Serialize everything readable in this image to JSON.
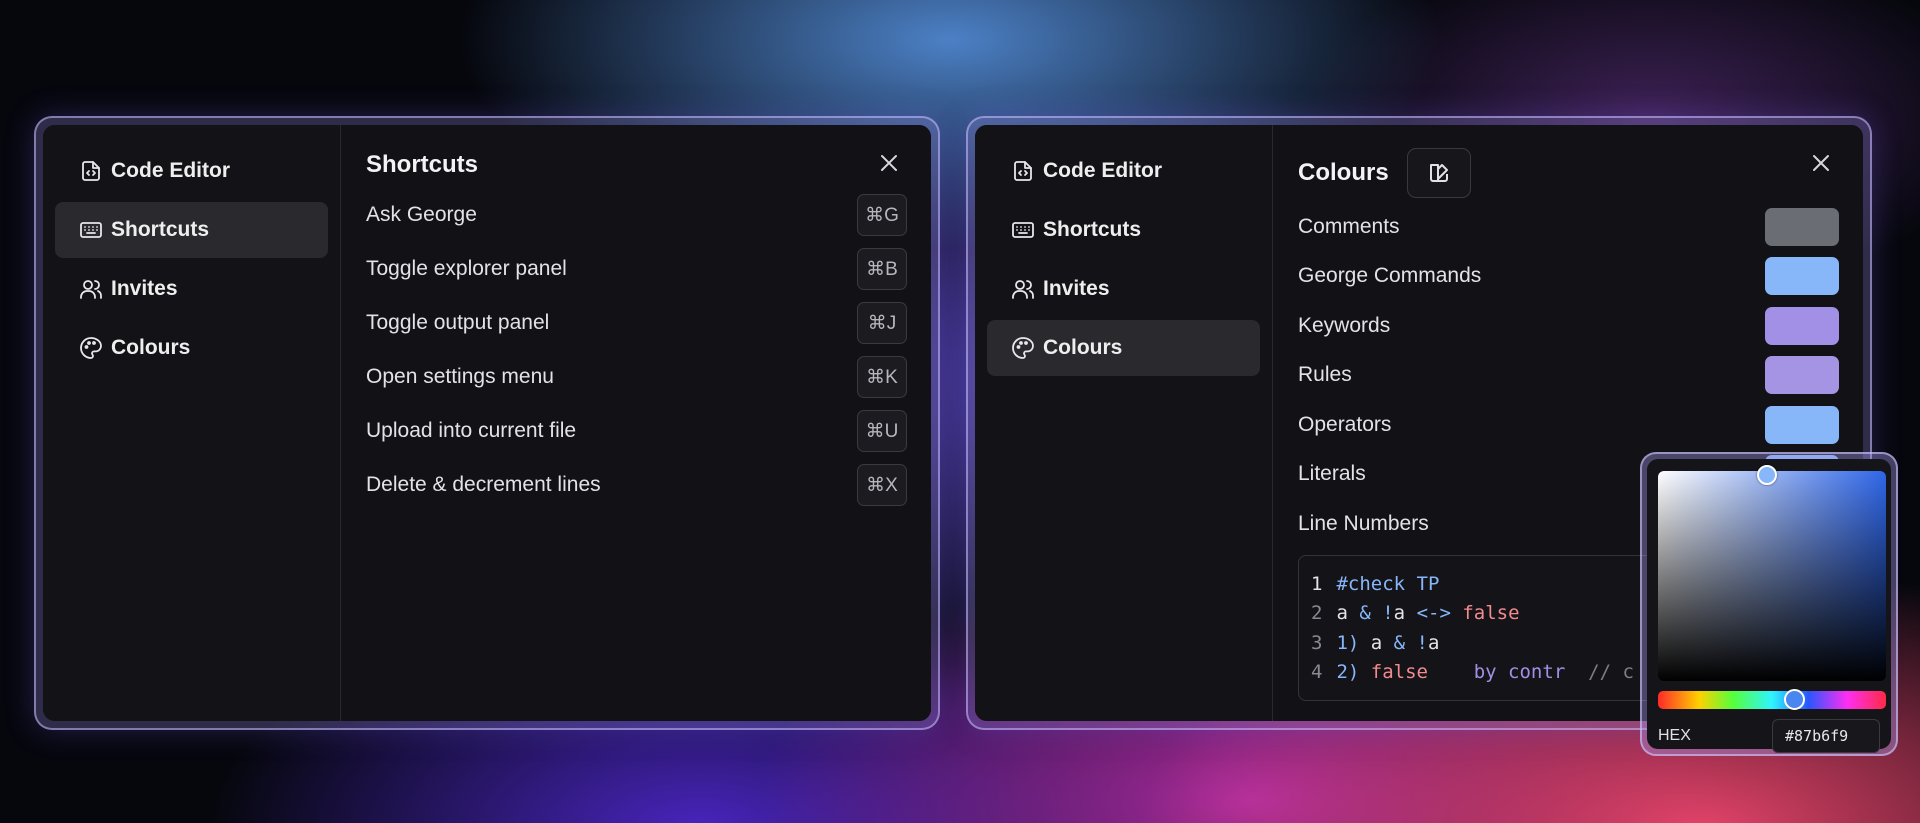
{
  "left_window": {
    "sidebar": [
      {
        "label": "Code Editor",
        "icon": "file-code-icon"
      },
      {
        "label": "Shortcuts",
        "icon": "keyboard-icon",
        "active": true
      },
      {
        "label": "Invites",
        "icon": "users-icon"
      },
      {
        "label": "Colours",
        "icon": "palette-icon"
      }
    ],
    "title": "Shortcuts",
    "shortcuts": [
      {
        "label": "Ask George",
        "key": "⌘G"
      },
      {
        "label": "Toggle explorer panel",
        "key": "⌘B"
      },
      {
        "label": "Toggle output panel",
        "key": "⌘J"
      },
      {
        "label": "Open settings menu",
        "key": "⌘K"
      },
      {
        "label": "Upload into current file",
        "key": "⌘U"
      },
      {
        "label": "Delete & decrement lines",
        "key": "⌘X"
      }
    ]
  },
  "right_window": {
    "sidebar": [
      {
        "label": "Code Editor",
        "icon": "file-code-icon"
      },
      {
        "label": "Shortcuts",
        "icon": "keyboard-icon"
      },
      {
        "label": "Invites",
        "icon": "users-icon"
      },
      {
        "label": "Colours",
        "icon": "palette-icon",
        "active": true
      }
    ],
    "title": "Colours",
    "colours": [
      {
        "label": "Comments",
        "color": "#6b6d74"
      },
      {
        "label": "George Commands",
        "color": "#87b6f9"
      },
      {
        "label": "Keywords",
        "color": "#a28fe6"
      },
      {
        "label": "Rules",
        "color": "#a593e3"
      },
      {
        "label": "Operators",
        "color": "#87b6f9"
      },
      {
        "label": "Literals",
        "color": "#87b6f9"
      },
      {
        "label": "Line Numbers",
        "color": "#6b6d74"
      }
    ],
    "code_lines": [
      {
        "num": "1",
        "tokens": [
          {
            "t": "#check TP",
            "c": "#87b6f9"
          }
        ]
      },
      {
        "num": "2",
        "tokens": [
          {
            "t": "a ",
            "c": "#e4e4e7"
          },
          {
            "t": "& !",
            "c": "#87b6f9"
          },
          {
            "t": "a ",
            "c": "#e4e4e7"
          },
          {
            "t": "<-> ",
            "c": "#87b6f9"
          },
          {
            "t": "false",
            "c": "#f28b8f"
          }
        ]
      },
      {
        "num": "3",
        "tokens": [
          {
            "t": "1) ",
            "c": "#87b6f9"
          },
          {
            "t": "a ",
            "c": "#e4e4e7"
          },
          {
            "t": "& !",
            "c": "#87b6f9"
          },
          {
            "t": "a",
            "c": "#e4e4e7"
          }
        ]
      },
      {
        "num": "4",
        "tokens": [
          {
            "t": "2) ",
            "c": "#87b6f9"
          },
          {
            "t": "false",
            "c": "#f28b8f"
          },
          {
            "t": "    by contr",
            "c": "#a28fe6"
          },
          {
            "t": "  // c",
            "c": "#7c7d85"
          }
        ]
      }
    ]
  },
  "color_picker": {
    "hex_label": "HEX",
    "hex_value": "#87b6f9"
  }
}
